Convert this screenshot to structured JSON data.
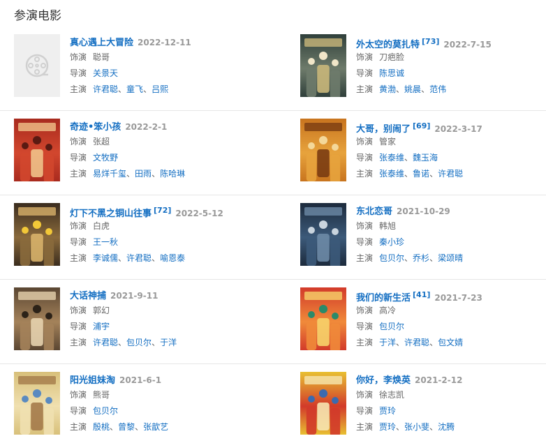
{
  "page": {
    "title": "参演电影"
  },
  "labels": {
    "role": "饰演",
    "director": "导演",
    "cast": "主演"
  },
  "films": [
    {
      "title": "真心遇上大冒险",
      "badge": "",
      "date": "2022-12-11",
      "role": "聪哥",
      "directors": [
        "关景天"
      ],
      "cast": [
        "许君聪",
        "童飞",
        "吕熙"
      ],
      "poster": {
        "type": "placeholder",
        "icon": "film-reel-icon",
        "colors": [
          "#efefef",
          "#d0d0d0"
        ]
      }
    },
    {
      "title": "外太空的莫扎特",
      "badge": "[73]",
      "date": "2022-7-15",
      "role": "刀疤脸",
      "directors": [
        "陈思诚"
      ],
      "cast": [
        "黄渤",
        "姚晨",
        "范伟"
      ],
      "poster": {
        "type": "image",
        "colors": [
          "#2f3f3a",
          "#6e7b6b",
          "#c9b77a",
          "#f1e6c8"
        ]
      }
    },
    {
      "title": "奇迹•笨小孩",
      "badge": "",
      "date": "2022-2-1",
      "role": "张超",
      "directors": [
        "文牧野"
      ],
      "cast": [
        "易烊千玺",
        "田雨",
        "陈哈琳"
      ],
      "poster": {
        "type": "image",
        "colors": [
          "#a82a1e",
          "#d2472e",
          "#f0c28a",
          "#5a1a12"
        ]
      }
    },
    {
      "title": "大哥，别闹了",
      "badge": "[69]",
      "date": "2022-3-17",
      "role": "管家",
      "directors": [
        "张泰维",
        "魏玉海"
      ],
      "cast": [
        "张泰维",
        "鲁诺",
        "许君聪"
      ],
      "poster": {
        "type": "image",
        "colors": [
          "#c8741e",
          "#e7a33d",
          "#7a3c12",
          "#f4d89a"
        ]
      }
    },
    {
      "title": "灯下不黑之铜山往事",
      "badge": "[72]",
      "date": "2022-5-12",
      "role": "白虎",
      "directors": [
        "王一秋"
      ],
      "cast": [
        "李诚儒",
        "许君聪",
        "喻恩泰"
      ],
      "poster": {
        "type": "image",
        "colors": [
          "#3a2c1e",
          "#8a6a3c",
          "#d8b26a",
          "#f2c838"
        ]
      }
    },
    {
      "title": "东北恋哥",
      "badge": "",
      "date": "2021-10-29",
      "role": "韩旭",
      "directors": [
        "秦小珍"
      ],
      "cast": [
        "包贝尔",
        "乔杉",
        "梁颂晴"
      ],
      "poster": {
        "type": "image",
        "colors": [
          "#1c2a3c",
          "#3c5a7a",
          "#6d8aa6",
          "#c9d4de"
        ]
      }
    },
    {
      "title": "大话神捕",
      "badge": "",
      "date": "2021-9-11",
      "role": "郭幻",
      "directors": [
        "浦宇"
      ],
      "cast": [
        "许君聪",
        "包贝尔",
        "于洋"
      ],
      "poster": {
        "type": "image",
        "colors": [
          "#5a4632",
          "#a4825a",
          "#e6d2ae",
          "#2c2218"
        ]
      }
    },
    {
      "title": "我们的新生活",
      "badge": "[41]",
      "date": "2021-7-23",
      "role": "高冷",
      "directors": [
        "包贝尔"
      ],
      "cast": [
        "于洋",
        "许君聪",
        "包文婧"
      ],
      "poster": {
        "type": "image",
        "colors": [
          "#d23a2a",
          "#f08a3a",
          "#f6d26a",
          "#2a8a6a"
        ]
      }
    },
    {
      "title": "阳光姐妹淘",
      "badge": "",
      "date": "2021-6-1",
      "role": "熊哥",
      "directors": [
        "包贝尔"
      ],
      "cast": [
        "殷桃",
        "曾黎",
        "张歆艺"
      ],
      "poster": {
        "type": "image",
        "colors": [
          "#d8c07a",
          "#f0e0b0",
          "#a47a4a",
          "#5a8ac0"
        ]
      }
    },
    {
      "title": "你好，李焕英",
      "badge": "",
      "date": "2021-2-12",
      "role": "徐志凯",
      "directors": [
        "贾玲"
      ],
      "cast": [
        "贾玲",
        "张小斐",
        "沈腾"
      ],
      "poster": {
        "type": "image",
        "colors": [
          "#e8c032",
          "#d23a2a",
          "#f6e6b0",
          "#3a6ab0"
        ]
      }
    }
  ]
}
